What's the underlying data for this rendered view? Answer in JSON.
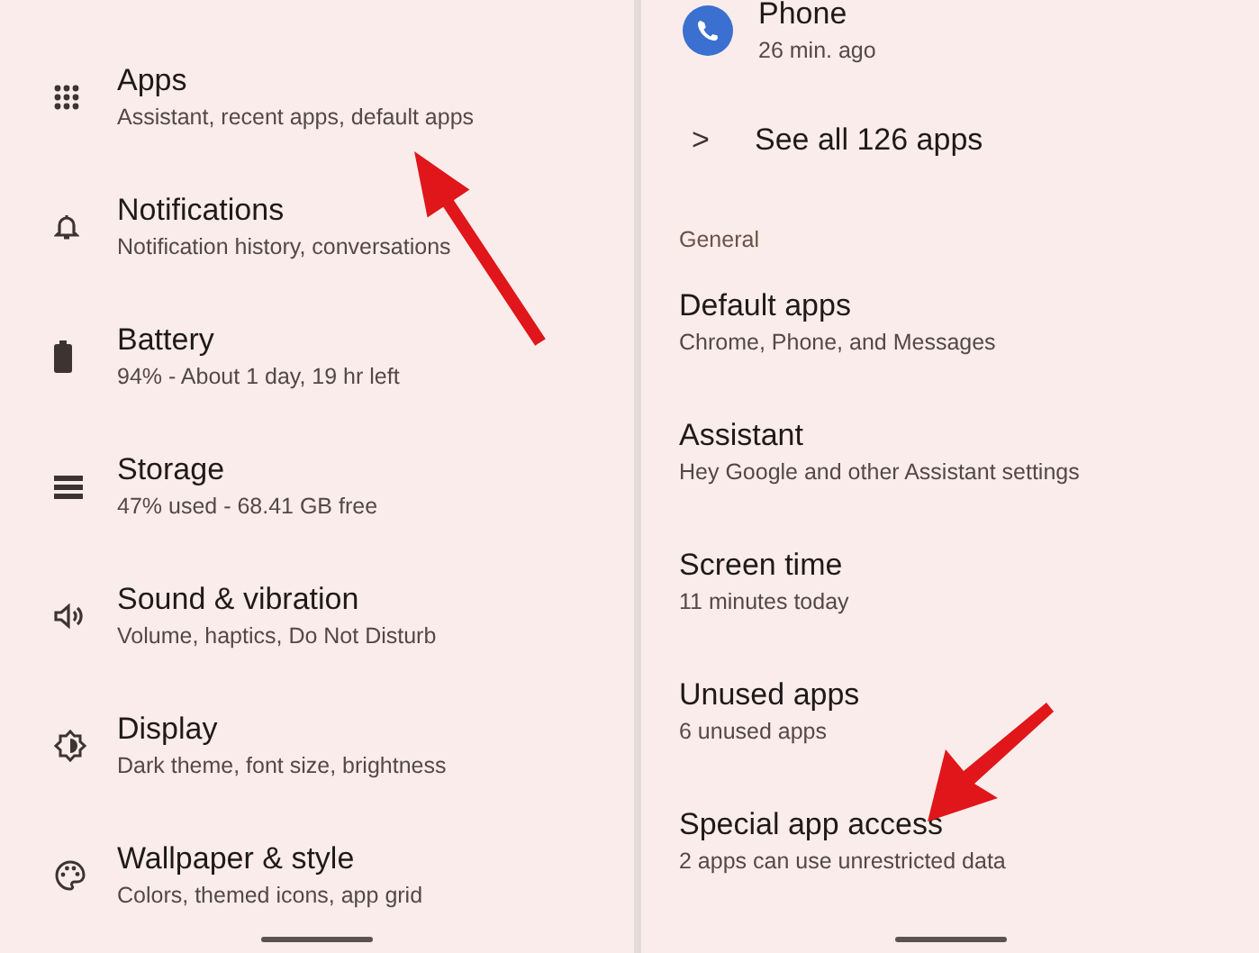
{
  "left_panel": {
    "items": [
      {
        "kind": "grid",
        "title": "Apps",
        "subtitle": "Assistant, recent apps, default apps"
      },
      {
        "kind": "bell",
        "title": "Notifications",
        "subtitle": "Notification history, conversations"
      },
      {
        "kind": "battery",
        "title": "Battery",
        "subtitle": "94% - About 1 day, 19 hr left"
      },
      {
        "kind": "storage",
        "title": "Storage",
        "subtitle": "47% used - 68.41 GB free"
      },
      {
        "kind": "speaker",
        "title": "Sound & vibration",
        "subtitle": "Volume, haptics, Do Not Disturb"
      },
      {
        "kind": "brightness",
        "title": "Display",
        "subtitle": "Dark theme, font size, brightness"
      },
      {
        "kind": "palette",
        "title": "Wallpaper & style",
        "subtitle": "Colors, themed icons, app grid"
      }
    ]
  },
  "right_panel": {
    "recent_app": {
      "title": "Phone",
      "subtitle": "26 min. ago"
    },
    "see_all": {
      "icon": ">",
      "label": "See all 126 apps"
    },
    "section_header": "General",
    "items": [
      {
        "title": "Default apps",
        "subtitle": "Chrome, Phone, and Messages"
      },
      {
        "title": "Assistant",
        "subtitle": "Hey Google and other Assistant settings"
      },
      {
        "title": "Screen time",
        "subtitle": "11 minutes today"
      },
      {
        "title": "Unused apps",
        "subtitle": "6 unused apps"
      },
      {
        "title": "Special app access",
        "subtitle": "2 apps can use unrestricted data"
      }
    ]
  }
}
